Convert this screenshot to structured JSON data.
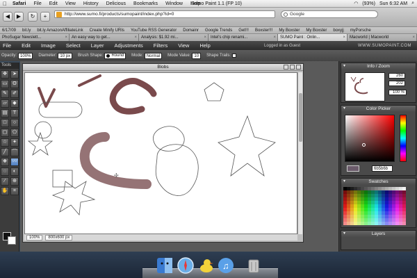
{
  "mac_menubar": {
    "app": "Safari",
    "items": [
      "File",
      "Edit",
      "View",
      "History",
      "Delicious",
      "Bookmarks",
      "Window",
      "Help"
    ],
    "window_title": "Sumo Paint 1.1 (FP 10)",
    "battery": "(93%)",
    "clock": "Sun 6:32 AM"
  },
  "browser": {
    "url": "http://www.sumo.fi/products/sumopaint/index.php?id=0",
    "search_placeholder": "Google",
    "bookmarks": [
      "6/17/09",
      "bit.ly",
      "bit.ly AmazonAffiliateLink",
      "Create Minify URIs",
      "YouTube RSS Generator",
      "Domainr",
      "Google Trends",
      "Get!!!",
      "Boxster!!!",
      "My Boxster",
      "My Boxster",
      "boxyjj",
      "myPorsche"
    ],
    "tabs": [
      {
        "label": "PhoSugar Newslett...",
        "active": false
      },
      {
        "label": "An easy way to get...",
        "active": false
      },
      {
        "label": "Analysis: $1.92 mi...",
        "active": false
      },
      {
        "label": "Intel's chip renami...",
        "active": false
      },
      {
        "label": "SUMO Paint : Onlin...",
        "active": true
      },
      {
        "label": "Macworld | Macworld",
        "active": false
      }
    ]
  },
  "app_menubar": {
    "items": [
      "File",
      "Edit",
      "Image",
      "Select",
      "Layer",
      "Adjustments",
      "Filters",
      "View",
      "Help"
    ],
    "login_status": "Logged in as Guest",
    "brand": "WWW.SUMOPAINT.COM"
  },
  "options_bar": {
    "opacity_label": "Opacity:",
    "opacity_value": "100%",
    "diameter_label": "Diameter:",
    "diameter_value": "10 px",
    "brush_shape_label": "Brush Shape:",
    "brush_shape_value": "Round",
    "mode_label": "Mode:",
    "mode_value": "Normal",
    "mode_value_label": "Mode Value:",
    "mode_value_value": "10",
    "shape_trails_label": "Shape Trails:"
  },
  "tools_panel": {
    "title": "Tools"
  },
  "document": {
    "title": "Blobs",
    "zoom": "100%",
    "size": "800x600 px"
  },
  "info_panel": {
    "title": "Info / Zoom",
    "x": "260",
    "y": "202",
    "zoom": "100 %"
  },
  "color_picker": {
    "title": "Color Picker",
    "hex": "6b5b6b"
  },
  "swatches": {
    "title": "Swatches"
  },
  "layers": {
    "title": "Layers"
  },
  "colors": {
    "stroke_brown": "#7a4a4c",
    "accent_blue": "#4f7fc0"
  }
}
